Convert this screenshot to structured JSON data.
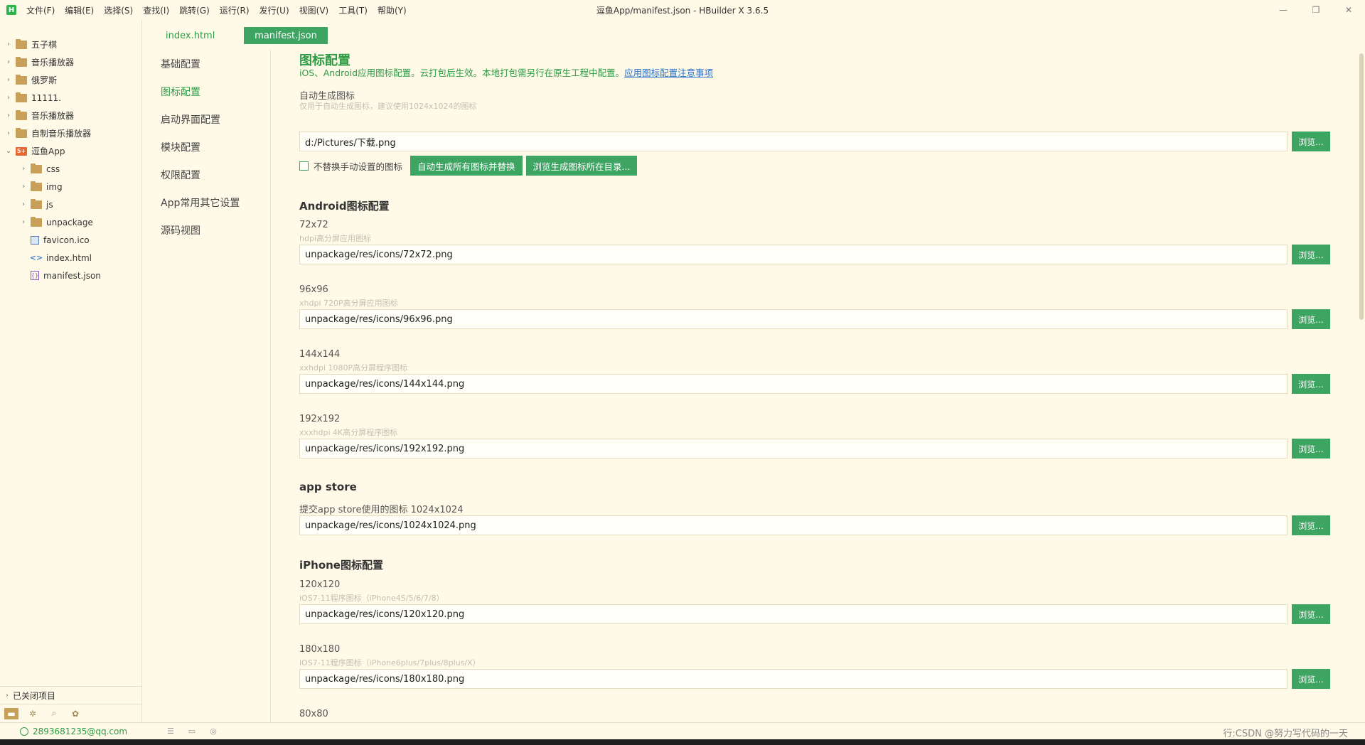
{
  "window": {
    "logo": "H",
    "title": "逗鱼App/manifest.json - HBuilder X 3.6.5",
    "menu": [
      "文件(F)",
      "编辑(E)",
      "选择(S)",
      "查找(I)",
      "跳转(G)",
      "运行(R)",
      "发行(U)",
      "视图(V)",
      "工具(T)",
      "帮助(Y)"
    ],
    "controls": {
      "minimize": "—",
      "maximize": "❐",
      "close": "✕"
    }
  },
  "sidebar": {
    "projects": [
      {
        "label": "五子棋"
      },
      {
        "label": "音乐播放器"
      },
      {
        "label": "俄罗斯"
      },
      {
        "label": "11111."
      },
      {
        "label": "音乐播放器"
      },
      {
        "label": "自制音乐播放器"
      }
    ],
    "open_project": {
      "label": "逗鱼App",
      "icon_text": "5+",
      "folders": [
        "css",
        "img",
        "js",
        "unpackage"
      ],
      "files": [
        "favicon.ico",
        "index.html",
        "manifest.json"
      ]
    },
    "closed_projects": "已关闭项目"
  },
  "tabs": [
    {
      "label": "index.html",
      "active": false
    },
    {
      "label": "manifest.json",
      "active": true
    }
  ],
  "config_nav": {
    "items": [
      "基础配置",
      "图标配置",
      "启动界面配置",
      "模块配置",
      "权限配置",
      "App常用其它设置",
      "源码视图"
    ],
    "active_index": 1
  },
  "main": {
    "title": "图标配置",
    "description": "iOS、Android应用图标配置。云打包后生效。本地打包需另行在原生工程中配置。",
    "description_link": "应用图标配置注意事项",
    "browse_label": "浏览...",
    "auto": {
      "label": "自动生成图标",
      "hint": "仅用于自动生成图标，建议使用1024x1024的图标",
      "value": "d:/Pictures/下载.png",
      "checkbox_label": "不替换手动设置的图标",
      "checked": false,
      "generate_button": "自动生成所有图标并替换",
      "open_dir_button": "浏览生成图标所在目录..."
    },
    "android": {
      "title": "Android图标配置",
      "fields": [
        {
          "label": "72x72",
          "hint": "hdpi高分屏应用图标",
          "value": "unpackage/res/icons/72x72.png"
        },
        {
          "label": "96x96",
          "hint": "xhdpi 720P高分屏应用图标",
          "value": "unpackage/res/icons/96x96.png"
        },
        {
          "label": "144x144",
          "hint": "xxhdpi 1080P高分屏程序图标",
          "value": "unpackage/res/icons/144x144.png"
        },
        {
          "label": "192x192",
          "hint": "xxxhdpi 4K高分屏程序图标",
          "value": "unpackage/res/icons/192x192.png"
        }
      ]
    },
    "appstore": {
      "title": "app store",
      "label": "提交app store使用的图标 1024x1024",
      "value": "unpackage/res/icons/1024x1024.png"
    },
    "iphone": {
      "title": "iPhone图标配置",
      "fields": [
        {
          "label": "120x120",
          "hint": "iOS7-11程序图标（iPhone4S/5/6/7/8）",
          "value": "unpackage/res/icons/120x120.png"
        },
        {
          "label": "180x180",
          "hint": "iOS7-11程序图标（iPhone6plus/7plus/8plus/X）",
          "value": "unpackage/res/icons/180x180.png"
        },
        {
          "label": "80x80"
        }
      ]
    }
  },
  "statusbar": {
    "account": "2893681235@qq.com",
    "right_text": "行:CSDN @努力写代码的一天"
  },
  "colors": {
    "accent": "#3ea462",
    "accent_text": "#2e9b45",
    "background": "#fffae8",
    "link": "#2a6fc9"
  }
}
